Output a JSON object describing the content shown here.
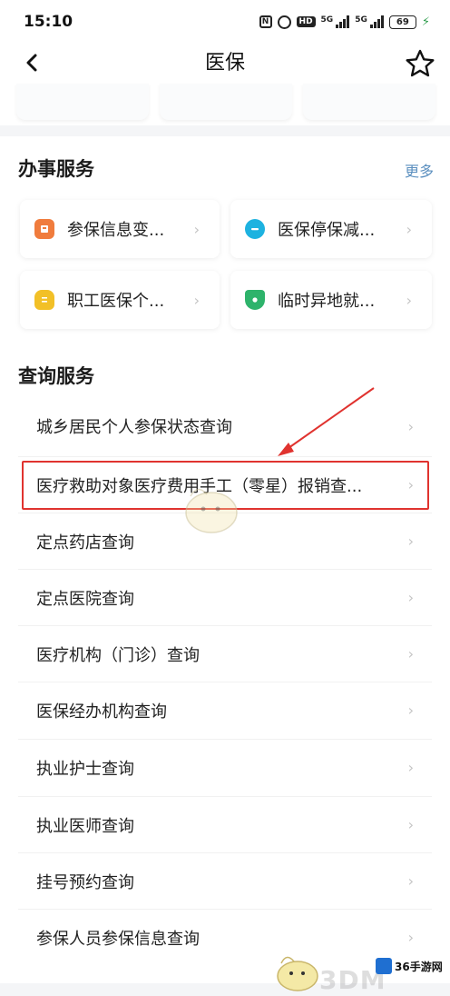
{
  "status_bar": {
    "time": "15:10",
    "network_1": "5G",
    "network_2": "5G",
    "hd": "HD",
    "battery": "69"
  },
  "nav": {
    "title": "医保",
    "back_icon": "chevron-left-icon",
    "favorite_icon": "star-outline-icon"
  },
  "business_services": {
    "title": "办事服务",
    "more_label": "更多",
    "items": [
      {
        "label": "参保信息变...",
        "icon": "id-card-icon",
        "color": "#f07c3d"
      },
      {
        "label": "医保停保减...",
        "icon": "minus-circle-icon",
        "color": "#1db2e0"
      },
      {
        "label": "职工医保个...",
        "icon": "money-bag-icon",
        "color": "#f2c027"
      },
      {
        "label": "临时异地就...",
        "icon": "shield-icon",
        "color": "#2eb36b"
      }
    ]
  },
  "query_services": {
    "title": "查询服务",
    "items": [
      {
        "label": "城乡居民个人参保状态查询"
      },
      {
        "label": "医疗救助对象医疗费用手工（零星）报销查..."
      },
      {
        "label": "定点药店查询"
      },
      {
        "label": "定点医院查询"
      },
      {
        "label": "医疗机构（门诊）查询"
      },
      {
        "label": "医保经办机构查询"
      },
      {
        "label": "执业护士查询"
      },
      {
        "label": "执业医师查询"
      },
      {
        "label": "挂号预约查询"
      },
      {
        "label": "参保人员参保信息查询"
      }
    ]
  },
  "annotation": {
    "color": "#e0332f"
  },
  "watermark": {
    "text": "36手游网",
    "text2": "3DM"
  }
}
